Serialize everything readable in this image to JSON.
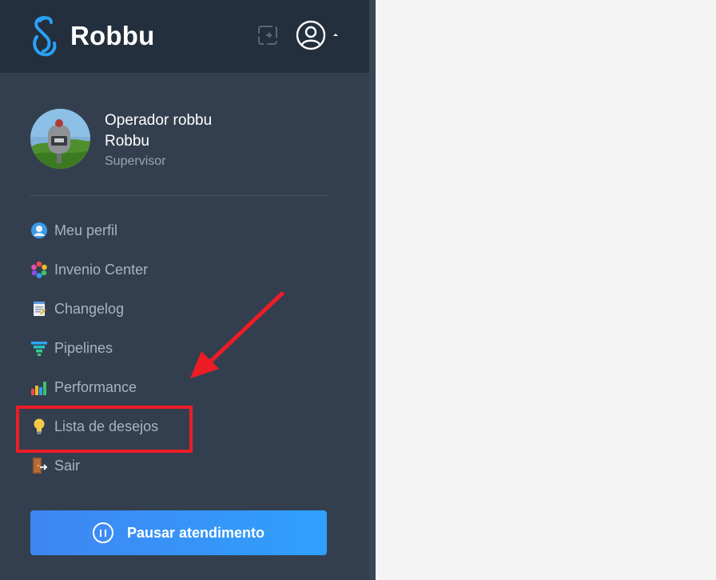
{
  "brand": {
    "name": "Robbu"
  },
  "header": {
    "icons": [
      "logout-icon",
      "user-circle-icon",
      "caret-up-icon"
    ]
  },
  "user": {
    "name": "Operador robbu",
    "company": "Robbu",
    "role": "Supervisor"
  },
  "menu": {
    "items": [
      {
        "label": "Meu perfil",
        "icon": "profile-icon"
      },
      {
        "label": "Invenio Center",
        "icon": "invenio-icon"
      },
      {
        "label": "Changelog",
        "icon": "changelog-icon"
      },
      {
        "label": "Pipelines",
        "icon": "funnel-icon"
      },
      {
        "label": "Performance",
        "icon": "bar-chart-icon"
      },
      {
        "label": "Lista de desejos",
        "icon": "lightbulb-icon"
      },
      {
        "label": "Sair",
        "icon": "exit-door-icon"
      }
    ]
  },
  "pause_button": {
    "label": "Pausar atendimento"
  },
  "colors": {
    "header": "#242f3e",
    "sidebar": "#333f4f",
    "accent": "#2fa0fb",
    "annotation": "#ee1c25"
  }
}
